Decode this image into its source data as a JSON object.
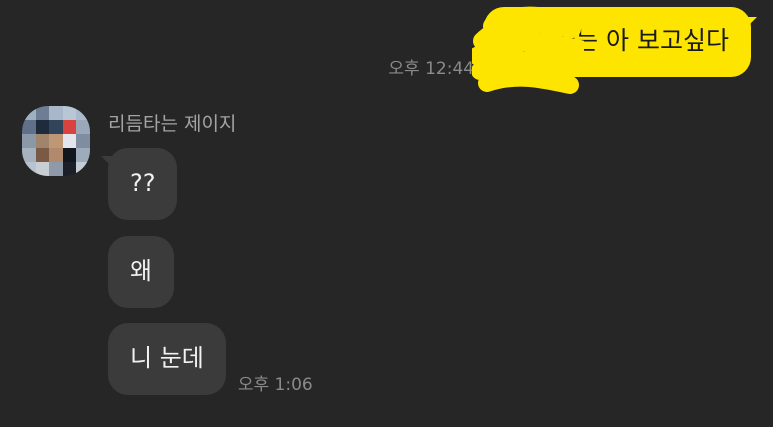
{
  "outgoing": {
    "message": "사랑하는 아 보고싶다",
    "time": "오후 12:44"
  },
  "incoming": {
    "sender": "리듬타는 제이지",
    "messages": [
      {
        "text": "??",
        "time": ""
      },
      {
        "text": "왜",
        "time": ""
      },
      {
        "text": "니 눈데",
        "time": "오후 1:06"
      }
    ]
  },
  "colors": {
    "background": "#262626",
    "outgoing_bubble": "#fee500",
    "incoming_bubble": "#3b3b3b",
    "time_text": "#8a8a8a",
    "sender_text": "#a4a4a4"
  },
  "icons": {
    "avatar": "pixelated-profile-avatar",
    "redaction": "yellow-scribble-redaction"
  }
}
